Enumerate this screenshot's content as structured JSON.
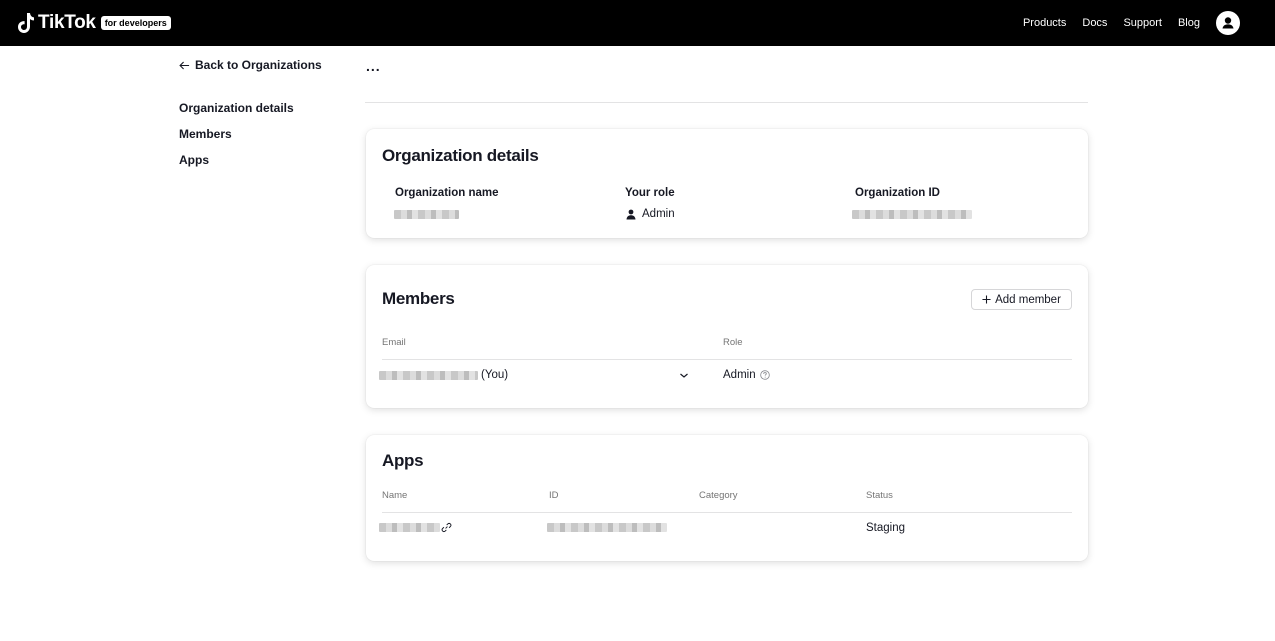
{
  "header": {
    "brand": "TikTok",
    "badge": "for developers",
    "nav": [
      "Products",
      "Docs",
      "Support",
      "Blog"
    ]
  },
  "sidebar": {
    "back_label": "Back to Organizations",
    "items": [
      "Organization details",
      "Members",
      "Apps"
    ]
  },
  "page": {
    "more_label": "..."
  },
  "org_details": {
    "title": "Organization details",
    "name_label": "Organization name",
    "role_label": "Your role",
    "role_value": "Admin",
    "id_label": "Organization ID"
  },
  "members": {
    "title": "Members",
    "add_label": "Add member",
    "col_email": "Email",
    "col_role": "Role",
    "rows": [
      {
        "you_suffix": "(You)",
        "role": "Admin"
      }
    ]
  },
  "apps": {
    "title": "Apps",
    "col_name": "Name",
    "col_id": "ID",
    "col_category": "Category",
    "col_status": "Status",
    "rows": [
      {
        "status": "Staging"
      }
    ]
  }
}
